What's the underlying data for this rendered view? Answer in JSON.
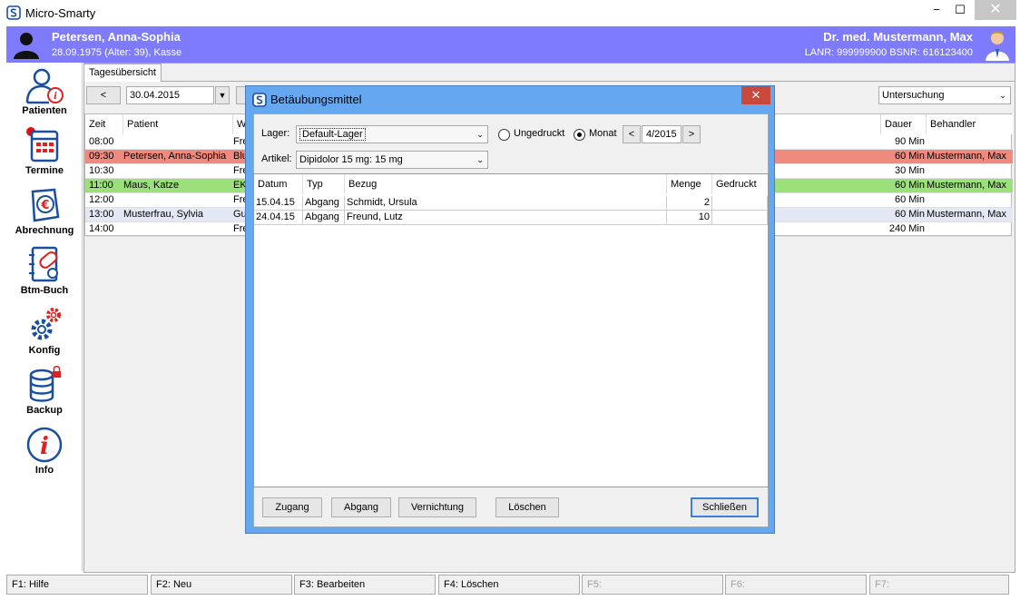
{
  "window": {
    "title": "Micro-Smarty",
    "minimize": "−",
    "maximize": "☐",
    "close": "✕"
  },
  "header": {
    "patient_name": "Petersen, Anna-Sophia",
    "patient_info": "28.09.1975 (Alter: 39), Kasse",
    "doctor_name": "Dr. med. Mustermann, Max",
    "doctor_info": "LANR: 999999900   BSNR: 616123400",
    "band_color": "#7e7bff"
  },
  "sidebar": {
    "items": [
      {
        "label": "Patienten",
        "icon": "patient-icon"
      },
      {
        "label": "Termine",
        "icon": "calendar-icon"
      },
      {
        "label": "Abrechnung",
        "icon": "billing-icon"
      },
      {
        "label": "Btm-Buch",
        "icon": "pill-book-icon"
      },
      {
        "label": "Konfig",
        "icon": "gear-icon"
      },
      {
        "label": "Backup",
        "icon": "database-icon"
      },
      {
        "label": "Info",
        "icon": "info-icon"
      }
    ]
  },
  "main": {
    "tab": "Tagesübersicht",
    "prev_button": "<",
    "date": "30.04.2015",
    "filter": "Untersuchung",
    "columns": {
      "zeit": "Zeit",
      "patient": "Patient",
      "was": "W",
      "dauer": "Dauer",
      "behandler": "Behandler"
    },
    "rows": [
      {
        "zeit": "08:00",
        "patient": "",
        "was": "Fre",
        "dauer": "90 Min",
        "behandler": ""
      },
      {
        "zeit": "09:30",
        "patient": "Petersen, Anna-Sophia",
        "was": "Blu",
        "dauer": "60 Min",
        "behandler": "Mustermann, Max"
      },
      {
        "zeit": "10:30",
        "patient": "",
        "was": "Fre",
        "dauer": "30 Min",
        "behandler": ""
      },
      {
        "zeit": "11:00",
        "patient": "Maus, Katze",
        "was": "EKG",
        "dauer": "60 Min",
        "behandler": "Mustermann, Max"
      },
      {
        "zeit": "12:00",
        "patient": "",
        "was": "Fre",
        "dauer": "60 Min",
        "behandler": ""
      },
      {
        "zeit": "13:00",
        "patient": "Musterfrau, Sylvia",
        "was": "Gu",
        "dauer": "60 Min",
        "behandler": "Mustermann, Max"
      },
      {
        "zeit": "14:00",
        "patient": "",
        "was": "Fre",
        "dauer": "240 Min",
        "behandler": ""
      }
    ]
  },
  "dialog": {
    "title": "Betäubungsmittel",
    "close": "✕",
    "lager_label": "Lager:",
    "lager_value": "Default-Lager",
    "radio_ungedruckt": "Ungedruckt",
    "radio_monat": "Monat",
    "month_prev": "<",
    "month_value": "4/2015",
    "month_next": ">",
    "artikel_label": "Artikel:",
    "artikel_value": "Dipidolor 15 mg: 15 mg",
    "columns": {
      "datum": "Datum",
      "typ": "Typ",
      "bezug": "Bezug",
      "menge": "Menge",
      "gedruckt": "Gedruckt"
    },
    "rows": [
      {
        "datum": "15.04.15",
        "typ": "Abgang",
        "bezug": "Schmidt, Ursula",
        "menge": "2",
        "gedruckt": ""
      },
      {
        "datum": "24.04.15",
        "typ": "Abgang",
        "bezug": "Freund, Lutz",
        "menge": "10",
        "gedruckt": ""
      }
    ],
    "buttons": {
      "zugang": "Zugang",
      "abgang": "Abgang",
      "vernichtung": "Vernichtung",
      "loeschen": "Löschen",
      "schliessen": "Schließen"
    }
  },
  "fkeys": [
    {
      "label": "F1: Hilfe",
      "enabled": true
    },
    {
      "label": "F2: Neu",
      "enabled": true
    },
    {
      "label": "F3: Bearbeiten",
      "enabled": true
    },
    {
      "label": "F4: Löschen",
      "enabled": true
    },
    {
      "label": "F5:",
      "enabled": false
    },
    {
      "label": "F6:",
      "enabled": false
    },
    {
      "label": "F7:",
      "enabled": false
    }
  ]
}
